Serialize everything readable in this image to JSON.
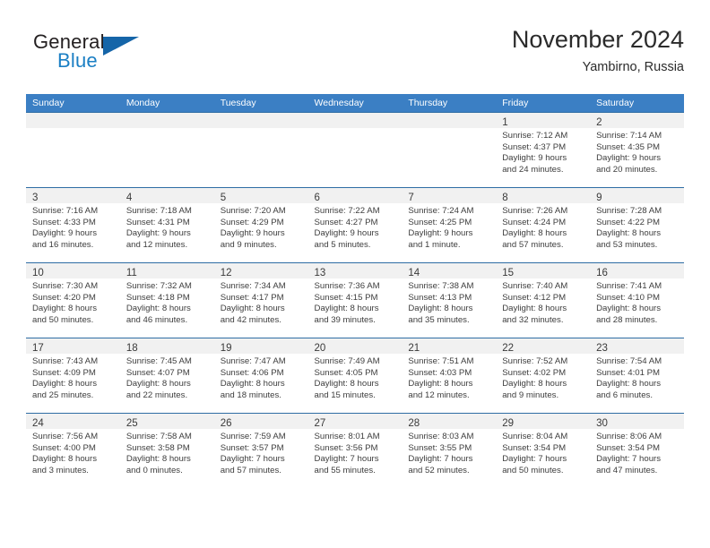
{
  "brand": {
    "word1": "General",
    "word2": "Blue",
    "logo_icon": "triangle-flag-icon",
    "colors": {
      "word1": "#231f20",
      "word2": "#1b7fc4",
      "triangle": "#1565a8"
    }
  },
  "header": {
    "title": "November 2024",
    "subtitle": "Yambirno, Russia"
  },
  "theme": {
    "header_row_bg": "#3b7fc4",
    "header_row_text": "#ffffff",
    "cell_top_border": "#2e6da4",
    "daynum_strip_bg": "#f1f1f1",
    "body_text": "#3d3d3d"
  },
  "weekday_headers": [
    "Sunday",
    "Monday",
    "Tuesday",
    "Wednesday",
    "Thursday",
    "Friday",
    "Saturday"
  ],
  "weeks": [
    [
      {
        "empty": true
      },
      {
        "empty": true
      },
      {
        "empty": true
      },
      {
        "empty": true
      },
      {
        "empty": true
      },
      {
        "day": "1",
        "sunrise": "Sunrise: 7:12 AM",
        "sunset": "Sunset: 4:37 PM",
        "daylight_line1": "Daylight: 9 hours",
        "daylight_line2": "and 24 minutes."
      },
      {
        "day": "2",
        "sunrise": "Sunrise: 7:14 AM",
        "sunset": "Sunset: 4:35 PM",
        "daylight_line1": "Daylight: 9 hours",
        "daylight_line2": "and 20 minutes."
      }
    ],
    [
      {
        "day": "3",
        "sunrise": "Sunrise: 7:16 AM",
        "sunset": "Sunset: 4:33 PM",
        "daylight_line1": "Daylight: 9 hours",
        "daylight_line2": "and 16 minutes."
      },
      {
        "day": "4",
        "sunrise": "Sunrise: 7:18 AM",
        "sunset": "Sunset: 4:31 PM",
        "daylight_line1": "Daylight: 9 hours",
        "daylight_line2": "and 12 minutes."
      },
      {
        "day": "5",
        "sunrise": "Sunrise: 7:20 AM",
        "sunset": "Sunset: 4:29 PM",
        "daylight_line1": "Daylight: 9 hours",
        "daylight_line2": "and 9 minutes."
      },
      {
        "day": "6",
        "sunrise": "Sunrise: 7:22 AM",
        "sunset": "Sunset: 4:27 PM",
        "daylight_line1": "Daylight: 9 hours",
        "daylight_line2": "and 5 minutes."
      },
      {
        "day": "7",
        "sunrise": "Sunrise: 7:24 AM",
        "sunset": "Sunset: 4:25 PM",
        "daylight_line1": "Daylight: 9 hours",
        "daylight_line2": "and 1 minute."
      },
      {
        "day": "8",
        "sunrise": "Sunrise: 7:26 AM",
        "sunset": "Sunset: 4:24 PM",
        "daylight_line1": "Daylight: 8 hours",
        "daylight_line2": "and 57 minutes."
      },
      {
        "day": "9",
        "sunrise": "Sunrise: 7:28 AM",
        "sunset": "Sunset: 4:22 PM",
        "daylight_line1": "Daylight: 8 hours",
        "daylight_line2": "and 53 minutes."
      }
    ],
    [
      {
        "day": "10",
        "sunrise": "Sunrise: 7:30 AM",
        "sunset": "Sunset: 4:20 PM",
        "daylight_line1": "Daylight: 8 hours",
        "daylight_line2": "and 50 minutes."
      },
      {
        "day": "11",
        "sunrise": "Sunrise: 7:32 AM",
        "sunset": "Sunset: 4:18 PM",
        "daylight_line1": "Daylight: 8 hours",
        "daylight_line2": "and 46 minutes."
      },
      {
        "day": "12",
        "sunrise": "Sunrise: 7:34 AM",
        "sunset": "Sunset: 4:17 PM",
        "daylight_line1": "Daylight: 8 hours",
        "daylight_line2": "and 42 minutes."
      },
      {
        "day": "13",
        "sunrise": "Sunrise: 7:36 AM",
        "sunset": "Sunset: 4:15 PM",
        "daylight_line1": "Daylight: 8 hours",
        "daylight_line2": "and 39 minutes."
      },
      {
        "day": "14",
        "sunrise": "Sunrise: 7:38 AM",
        "sunset": "Sunset: 4:13 PM",
        "daylight_line1": "Daylight: 8 hours",
        "daylight_line2": "and 35 minutes."
      },
      {
        "day": "15",
        "sunrise": "Sunrise: 7:40 AM",
        "sunset": "Sunset: 4:12 PM",
        "daylight_line1": "Daylight: 8 hours",
        "daylight_line2": "and 32 minutes."
      },
      {
        "day": "16",
        "sunrise": "Sunrise: 7:41 AM",
        "sunset": "Sunset: 4:10 PM",
        "daylight_line1": "Daylight: 8 hours",
        "daylight_line2": "and 28 minutes."
      }
    ],
    [
      {
        "day": "17",
        "sunrise": "Sunrise: 7:43 AM",
        "sunset": "Sunset: 4:09 PM",
        "daylight_line1": "Daylight: 8 hours",
        "daylight_line2": "and 25 minutes."
      },
      {
        "day": "18",
        "sunrise": "Sunrise: 7:45 AM",
        "sunset": "Sunset: 4:07 PM",
        "daylight_line1": "Daylight: 8 hours",
        "daylight_line2": "and 22 minutes."
      },
      {
        "day": "19",
        "sunrise": "Sunrise: 7:47 AM",
        "sunset": "Sunset: 4:06 PM",
        "daylight_line1": "Daylight: 8 hours",
        "daylight_line2": "and 18 minutes."
      },
      {
        "day": "20",
        "sunrise": "Sunrise: 7:49 AM",
        "sunset": "Sunset: 4:05 PM",
        "daylight_line1": "Daylight: 8 hours",
        "daylight_line2": "and 15 minutes."
      },
      {
        "day": "21",
        "sunrise": "Sunrise: 7:51 AM",
        "sunset": "Sunset: 4:03 PM",
        "daylight_line1": "Daylight: 8 hours",
        "daylight_line2": "and 12 minutes."
      },
      {
        "day": "22",
        "sunrise": "Sunrise: 7:52 AM",
        "sunset": "Sunset: 4:02 PM",
        "daylight_line1": "Daylight: 8 hours",
        "daylight_line2": "and 9 minutes."
      },
      {
        "day": "23",
        "sunrise": "Sunrise: 7:54 AM",
        "sunset": "Sunset: 4:01 PM",
        "daylight_line1": "Daylight: 8 hours",
        "daylight_line2": "and 6 minutes."
      }
    ],
    [
      {
        "day": "24",
        "sunrise": "Sunrise: 7:56 AM",
        "sunset": "Sunset: 4:00 PM",
        "daylight_line1": "Daylight: 8 hours",
        "daylight_line2": "and 3 minutes."
      },
      {
        "day": "25",
        "sunrise": "Sunrise: 7:58 AM",
        "sunset": "Sunset: 3:58 PM",
        "daylight_line1": "Daylight: 8 hours",
        "daylight_line2": "and 0 minutes."
      },
      {
        "day": "26",
        "sunrise": "Sunrise: 7:59 AM",
        "sunset": "Sunset: 3:57 PM",
        "daylight_line1": "Daylight: 7 hours",
        "daylight_line2": "and 57 minutes."
      },
      {
        "day": "27",
        "sunrise": "Sunrise: 8:01 AM",
        "sunset": "Sunset: 3:56 PM",
        "daylight_line1": "Daylight: 7 hours",
        "daylight_line2": "and 55 minutes."
      },
      {
        "day": "28",
        "sunrise": "Sunrise: 8:03 AM",
        "sunset": "Sunset: 3:55 PM",
        "daylight_line1": "Daylight: 7 hours",
        "daylight_line2": "and 52 minutes."
      },
      {
        "day": "29",
        "sunrise": "Sunrise: 8:04 AM",
        "sunset": "Sunset: 3:54 PM",
        "daylight_line1": "Daylight: 7 hours",
        "daylight_line2": "and 50 minutes."
      },
      {
        "day": "30",
        "sunrise": "Sunrise: 8:06 AM",
        "sunset": "Sunset: 3:54 PM",
        "daylight_line1": "Daylight: 7 hours",
        "daylight_line2": "and 47 minutes."
      }
    ]
  ]
}
